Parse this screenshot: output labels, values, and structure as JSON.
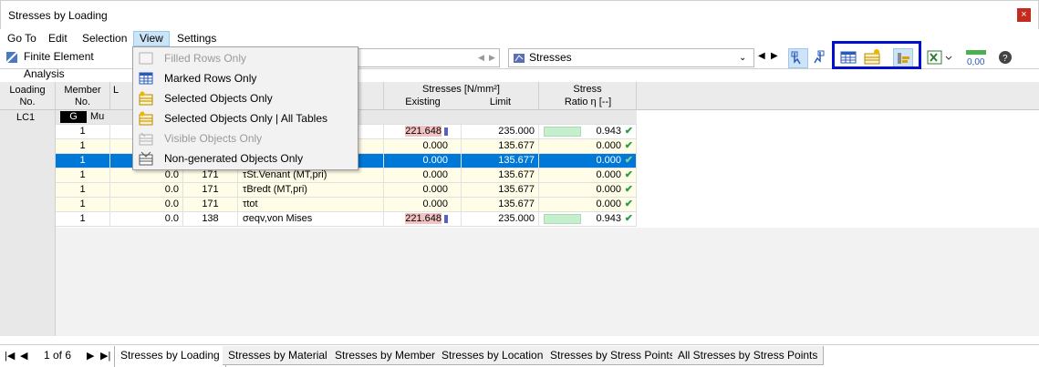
{
  "window": {
    "title": "Stresses by Loading",
    "close_glyph": "×"
  },
  "menubar": {
    "items": [
      "Go To",
      "Edit",
      "Selection",
      "View",
      "Settings"
    ],
    "active": "View"
  },
  "toolbar": {
    "analysis_label": "Finite Element Analysis",
    "stresses_label": "Stresses"
  },
  "view_menu": {
    "items": [
      {
        "label": "Filled Rows Only",
        "enabled": false,
        "icon": "filled-rows-icon"
      },
      {
        "label": "Marked Rows Only",
        "enabled": true,
        "icon": "marked-rows-icon"
      },
      {
        "label": "Selected Objects Only",
        "enabled": true,
        "icon": "selected-objects-icon"
      },
      {
        "label": "Selected Objects Only | All Tables",
        "enabled": true,
        "icon": "selected-objects-all-tables-icon"
      },
      {
        "label": "Visible Objects Only",
        "enabled": false,
        "icon": "visible-objects-icon"
      },
      {
        "label": "Non-generated Objects Only",
        "enabled": true,
        "icon": "non-generated-objects-icon"
      }
    ]
  },
  "table": {
    "headers": {
      "loading": "Loading\nNo.",
      "member": "Member\nNo.",
      "location_partial": "L",
      "stresses_group": "Stresses [N/mm²]",
      "existing": "Existing",
      "limit": "Limit",
      "ratio_group": "Stress",
      "ratio": "Ratio η [--]"
    },
    "lc_label": "LC1",
    "group_tag": "G",
    "group_text": "Mu",
    "rows": [
      {
        "member": "1",
        "loc": "",
        "point": "",
        "type": "",
        "existing": "221.648",
        "limit": "235.000",
        "ratio": "0.943",
        "ratio_value": 0.943,
        "style": "white",
        "ind": true
      },
      {
        "member": "1",
        "loc": "",
        "point": "",
        "type": "",
        "existing": "0.000",
        "limit": "135.677",
        "ratio": "0.000",
        "ratio_value": 0,
        "style": "yellow",
        "ind": false
      },
      {
        "member": "1",
        "loc": "",
        "point": "",
        "type": "",
        "existing": "0.000",
        "limit": "135.677",
        "ratio": "0.000",
        "ratio_value": 0,
        "style": "selected",
        "ind": false
      },
      {
        "member": "1",
        "loc": "0.0",
        "point": "171",
        "type": "τSt.Venant (MT,pri)",
        "existing": "0.000",
        "limit": "135.677",
        "ratio": "0.000",
        "ratio_value": 0,
        "style": "yellow",
        "ind": false
      },
      {
        "member": "1",
        "loc": "0.0",
        "point": "171",
        "type": "τBredt (MT,pri)",
        "existing": "0.000",
        "limit": "135.677",
        "ratio": "0.000",
        "ratio_value": 0,
        "style": "yellow",
        "ind": false
      },
      {
        "member": "1",
        "loc": "0.0",
        "point": "171",
        "type": "τtot",
        "existing": "0.000",
        "limit": "135.677",
        "ratio": "0.000",
        "ratio_value": 0,
        "style": "yellow",
        "ind": false
      },
      {
        "member": "1",
        "loc": "0.0",
        "point": "138",
        "type": "σeqv,von Mises",
        "existing": "221.648",
        "limit": "235.000",
        "ratio": "0.943",
        "ratio_value": 0.943,
        "style": "white",
        "ind": true
      }
    ]
  },
  "statusbar": {
    "page": "1 of 6",
    "tabs": [
      "Stresses by Loading",
      "Stresses by Material",
      "Stresses by Member",
      "Stresses by Location",
      "Stresses by Stress Points",
      "All Stresses by Stress Points"
    ],
    "active_tab": "Stresses by Loading"
  },
  "colors": {
    "selection": "#0078d7",
    "highlight_box": "#0010cc",
    "ok_check": "#2e9e44"
  }
}
